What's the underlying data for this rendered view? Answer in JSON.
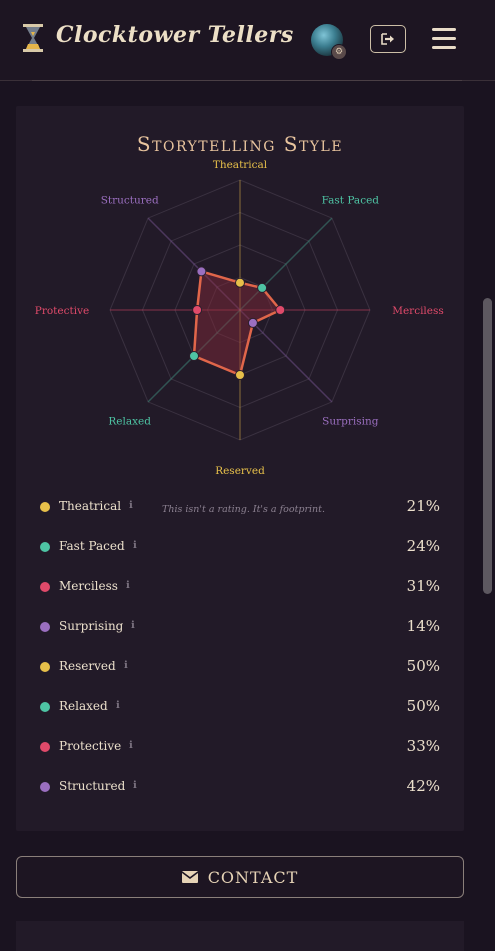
{
  "header": {
    "brand": "Clocktower Tellers",
    "logo_icon": "hourglass-icon",
    "avatar_icon": "avatar-image",
    "logout_icon": "sign-out-icon",
    "menu_icon": "hamburger-menu-icon"
  },
  "card": {
    "title": "Storytelling Style",
    "note": "This isn't a rating. It's a footprint."
  },
  "chart_data": {
    "type": "radar",
    "axes": [
      "Theatrical",
      "Fast Paced",
      "Merciless",
      "Surprising",
      "Reserved",
      "Relaxed",
      "Protective",
      "Structured"
    ],
    "values": [
      21,
      24,
      31,
      14,
      50,
      50,
      33,
      42
    ],
    "colors": [
      "#e7c04a",
      "#4ec4a4",
      "#e04a6a",
      "#9b6fc0",
      "#e7c04a",
      "#4ec4a4",
      "#e04a6a",
      "#9b6fc0"
    ],
    "range": [
      0,
      100
    ],
    "unit": "%"
  },
  "legend": [
    {
      "label": "Theatrical",
      "pct": "21%",
      "color": "#e7c04a"
    },
    {
      "label": "Fast Paced",
      "pct": "24%",
      "color": "#4ec4a4"
    },
    {
      "label": "Merciless",
      "pct": "31%",
      "color": "#e04a6a"
    },
    {
      "label": "Surprising",
      "pct": "14%",
      "color": "#9b6fc0"
    },
    {
      "label": "Reserved",
      "pct": "50%",
      "color": "#e7c04a"
    },
    {
      "label": "Relaxed",
      "pct": "50%",
      "color": "#4ec4a4"
    },
    {
      "label": "Protective",
      "pct": "33%",
      "color": "#e04a6a"
    },
    {
      "label": "Structured",
      "pct": "42%",
      "color": "#9b6fc0"
    }
  ],
  "info_glyph": "ℹ",
  "contact": {
    "label": "CONTACT",
    "icon": "envelope-icon"
  }
}
